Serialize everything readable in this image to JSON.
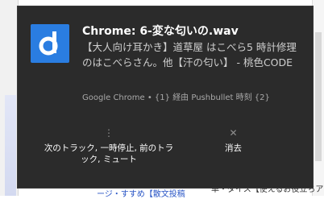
{
  "background": {
    "bottom_text": "単・ダイス【使えるお役立ちアップ",
    "bottom_link": "ージ・すすめ【散文投稿"
  },
  "notification": {
    "icon_name": "pushbullet-d-icon",
    "title": "Chrome: 6-変な匂いの.wav",
    "body": "【大人向け耳かき】道草屋 はこべら5 時計修理のはこべらさん。他【汗の匂い】 - 桃色CODE",
    "attribution": "Google Chrome • {1} 経由 Pushbullet 時刻 {2}",
    "actions": [
      {
        "glyph": "⋮",
        "label": "次のトラック, 一時停止, 前のトラック, ミュート"
      },
      {
        "glyph": "✕",
        "label": "消去"
      }
    ],
    "colors": {
      "toast_background": "#2b2b2b",
      "app_icon": "#2a7de1"
    }
  }
}
